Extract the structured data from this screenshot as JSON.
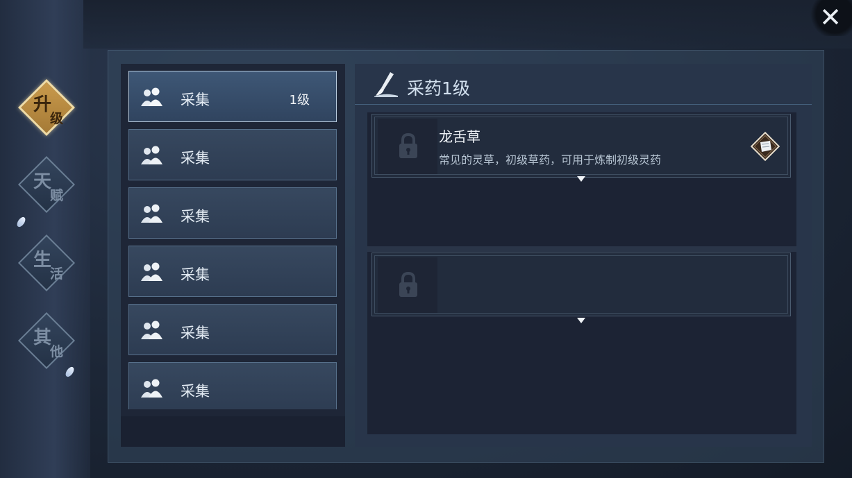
{
  "close": {
    "glyph": "✕"
  },
  "side_nav": [
    {
      "top": "升",
      "bottom": "级"
    },
    {
      "top": "天",
      "bottom": "赋"
    },
    {
      "top": "生",
      "bottom": "活"
    },
    {
      "top": "其",
      "bottom": "他"
    }
  ],
  "skill_list": [
    {
      "label": "采集",
      "level": "1级"
    },
    {
      "label": "采集",
      "level": ""
    },
    {
      "label": "采集",
      "level": ""
    },
    {
      "label": "采集",
      "level": ""
    },
    {
      "label": "采集",
      "level": ""
    },
    {
      "label": "采集",
      "level": ""
    }
  ],
  "detail": {
    "title": "采药1级",
    "items": [
      {
        "name": "龙舌草",
        "desc": "常见的灵草，初级草药，可用于炼制初级灵药",
        "locked": true
      },
      {
        "name": "",
        "desc": "",
        "locked": true
      }
    ]
  },
  "colors": {
    "accent_gold": "#c99a4c",
    "title_blue": "#d2e0ee",
    "selected_border": "#b9ccdf"
  },
  "icons": [
    "close-icon",
    "people-icon",
    "brush-icon",
    "lock-icon",
    "scroll-badge-icon",
    "expand-arrow-icon"
  ]
}
